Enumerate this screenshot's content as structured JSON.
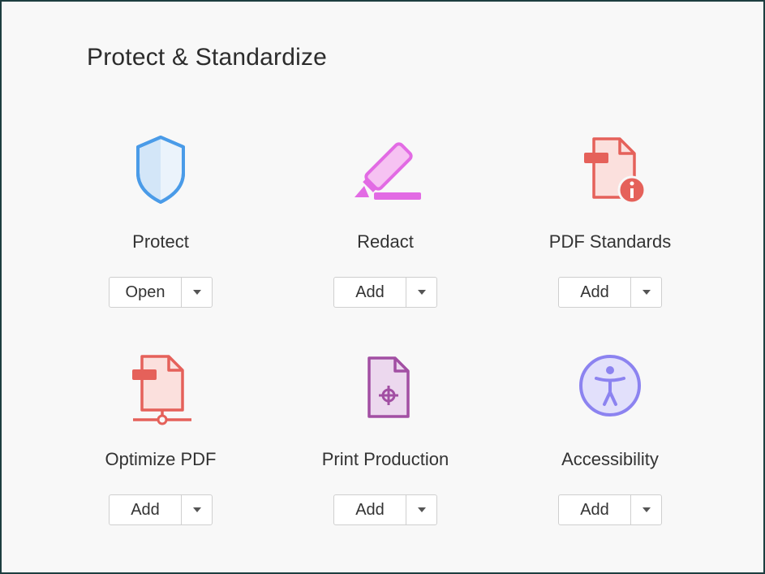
{
  "panel": {
    "title": "Protect & Standardize"
  },
  "tools": [
    {
      "label": "Protect",
      "button": "Open",
      "icon": "shield-icon",
      "color": "#4a9be8"
    },
    {
      "label": "Redact",
      "button": "Add",
      "icon": "redact-marker-icon",
      "color": "#e26be4"
    },
    {
      "label": "PDF Standards",
      "button": "Add",
      "icon": "pdf-standards-icon",
      "color": "#e5615a"
    },
    {
      "label": "Optimize PDF",
      "button": "Add",
      "icon": "optimize-pdf-icon",
      "color": "#e5615a"
    },
    {
      "label": "Print Production",
      "button": "Add",
      "icon": "print-production-icon",
      "color": "#a24fa3"
    },
    {
      "label": "Accessibility",
      "button": "Add",
      "icon": "accessibility-icon",
      "color": "#8c83f0"
    }
  ]
}
